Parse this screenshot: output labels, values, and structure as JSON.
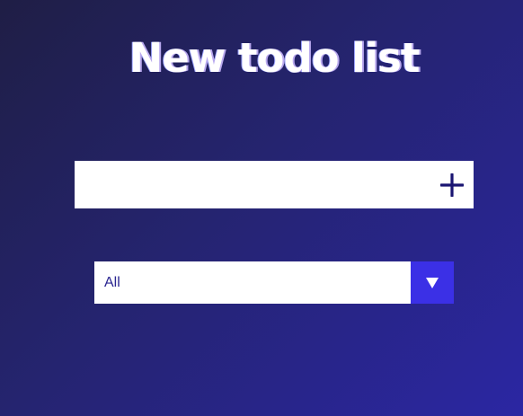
{
  "header": {
    "title": "New todo list"
  },
  "todo_form": {
    "input_value": "",
    "input_placeholder": "",
    "add_icon": "plus-icon"
  },
  "filter": {
    "selected": "All",
    "dropdown_icon": "triangle-down-icon"
  },
  "colors": {
    "background_start": "#1f1e45",
    "background_end": "#2b26a3",
    "accent": "#3b30e6",
    "icon": "#1a1572",
    "text": "#2a2591"
  }
}
